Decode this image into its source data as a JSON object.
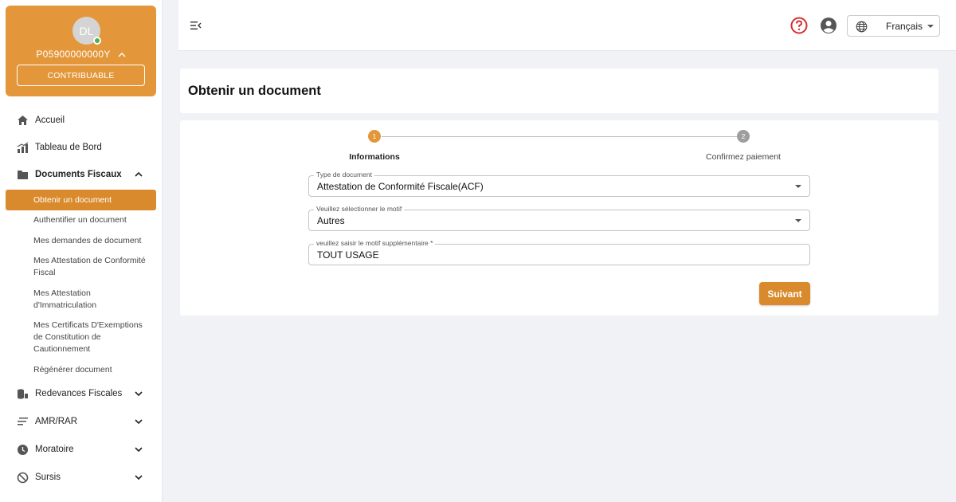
{
  "profile": {
    "initials": "DL",
    "user_id": "P05900000000Y",
    "role_label": "CONTRIBUABLE"
  },
  "sidebar": {
    "items": [
      {
        "label": "Accueil",
        "icon": "home-icon"
      },
      {
        "label": "Tableau de Bord",
        "icon": "bar-chart-icon"
      },
      {
        "label": "Documents Fiscaux",
        "icon": "folder-icon",
        "expanded": true
      },
      {
        "label": "Redevances Fiscales",
        "icon": "coins-icon"
      },
      {
        "label": "AMR/RAR",
        "icon": "list-icon"
      },
      {
        "label": "Moratoire",
        "icon": "clock-icon"
      },
      {
        "label": "Sursis",
        "icon": "block-icon"
      }
    ],
    "subitems": [
      {
        "label": "Obtenir un document",
        "active": true
      },
      {
        "label": "Authentifier un document"
      },
      {
        "label": "Mes demandes de document"
      },
      {
        "label": "Mes Attestation de Conformité Fiscal"
      },
      {
        "label": "Mes Attestation d'Immatriculation"
      },
      {
        "label": "Mes Certificats D'Exemptions de Constitution de Cautionnement"
      },
      {
        "label": "Régénérer document"
      }
    ]
  },
  "topbar": {
    "language": "Français"
  },
  "page": {
    "title": "Obtenir un document"
  },
  "stepper": {
    "steps": [
      {
        "number": "1",
        "label": "Informations",
        "active": true
      },
      {
        "number": "2",
        "label": "Confirmez paiement",
        "active": false
      }
    ]
  },
  "form": {
    "document_type": {
      "label": "Type de document",
      "value": "Attestation de Conformité Fiscale(ACF)"
    },
    "motif": {
      "label": "Veuillez sélectionner le motif",
      "value": "Autres"
    },
    "motif_supp": {
      "label": "veuillez saisir le motif supplémentaire *",
      "value": "TOUT USAGE"
    },
    "next_label": "Suivant"
  },
  "colors": {
    "accent": "#d98a2c",
    "profile_bg": "#e3973a",
    "step_inactive": "#9e9e9e",
    "help_red": "#d32f2f",
    "online": "#4caf50"
  }
}
